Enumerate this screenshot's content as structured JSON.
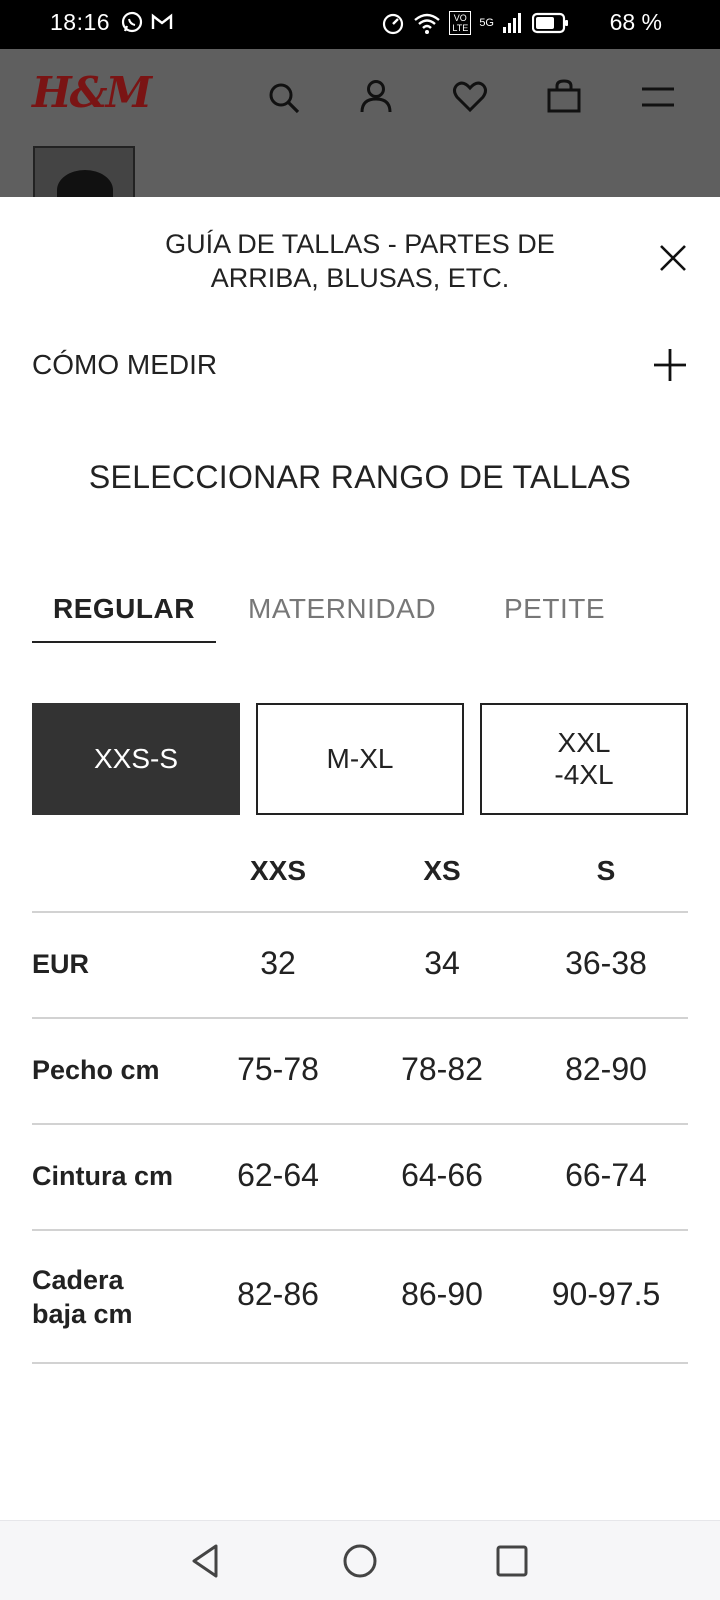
{
  "status_bar": {
    "time": "18:16",
    "battery": "68 %",
    "network": "5G",
    "volte": "VO LTE"
  },
  "header": {
    "logo": "H&M"
  },
  "sheet": {
    "title_line1": "GUÍA DE TALLAS - PARTES DE",
    "title_line2": "ARRIBA, BLUSAS, ETC.",
    "how_to_measure": "CÓMO MEDIR",
    "range_heading": "SELECCIONAR RANGO DE TALLAS",
    "tabs": [
      {
        "label": "REGULAR",
        "active": true
      },
      {
        "label": "MATERNIDAD",
        "active": false
      },
      {
        "label": "PETITE",
        "active": false
      }
    ],
    "size_ranges": [
      {
        "label": "XXS-S",
        "active": true
      },
      {
        "label": "M-XL",
        "active": false
      },
      {
        "label": "XXL-4XL",
        "active": false
      }
    ],
    "table": {
      "columns": [
        "XXS",
        "XS",
        "S"
      ],
      "rows": [
        {
          "label": "EUR",
          "values": [
            "32",
            "34",
            "36-38"
          ]
        },
        {
          "label": "Pecho cm",
          "values": [
            "75-78",
            "78-82",
            "82-90"
          ]
        },
        {
          "label": "Cintura cm",
          "values": [
            "62-64",
            "64-66",
            "66-74"
          ]
        },
        {
          "label": "Cadera baja cm",
          "values": [
            "82-86",
            "86-90",
            "90-97.5"
          ]
        }
      ]
    }
  },
  "colors": {
    "brand": "#7a1414",
    "active_range_bg": "#333333",
    "backdrop": "#5f5f5f"
  }
}
